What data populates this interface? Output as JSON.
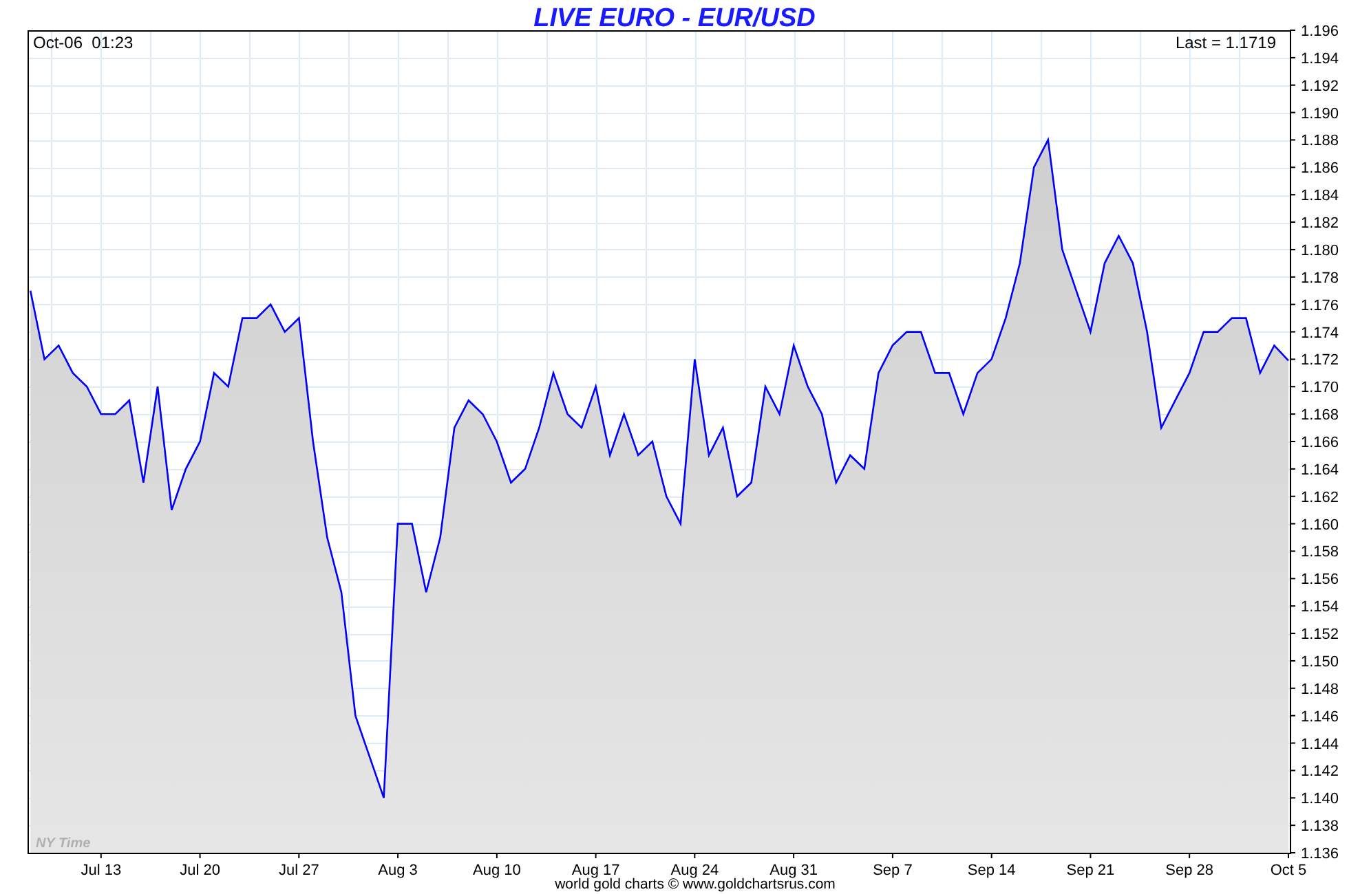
{
  "chart": {
    "timestamp": "Oct-06  01:23",
    "last_price": "Last = 1.1719",
    "timezone_label": "NY Time",
    "footer": "world gold charts © www.goldchartsrus.com",
    "chart_data": {
      "type": "area",
      "title": "LIVE EURO - EUR/USD",
      "categories": [
        null,
        null,
        null,
        null,
        null,
        "Jul 13",
        null,
        null,
        null,
        null,
        null,
        null,
        "Jul 20",
        null,
        null,
        null,
        null,
        null,
        null,
        "Jul 27",
        null,
        null,
        null,
        null,
        null,
        null,
        "Aug 3",
        null,
        null,
        null,
        null,
        null,
        null,
        "Aug 10",
        null,
        null,
        null,
        null,
        null,
        null,
        "Aug 17",
        null,
        null,
        null,
        null,
        null,
        null,
        "Aug 24",
        null,
        null,
        null,
        null,
        null,
        null,
        "Aug 31",
        null,
        null,
        null,
        null,
        null,
        null,
        "Sep 7",
        null,
        null,
        null,
        null,
        null,
        null,
        "Sep 14",
        null,
        null,
        null,
        null,
        null,
        null,
        "Sep 21",
        null,
        null,
        null,
        null,
        null,
        null,
        "Sep 28",
        null,
        null,
        null,
        null,
        null,
        null,
        "Oct 5"
      ],
      "series": [
        {
          "color": "#0000ff",
          "values": [
            1.177,
            1.172,
            1.173,
            1.171,
            1.17,
            1.168,
            1.168,
            1.169,
            1.163,
            1.17,
            1.161,
            1.164,
            1.166,
            1.171,
            1.17,
            1.175,
            1.175,
            1.176,
            1.174,
            1.175,
            1.166,
            1.159,
            1.155,
            1.146,
            1.143,
            1.14,
            1.16,
            1.16,
            1.155,
            1.159,
            1.167,
            1.169,
            1.168,
            1.166,
            1.163,
            1.164,
            1.167,
            1.171,
            1.168,
            1.167,
            1.17,
            1.165,
            1.168,
            1.165,
            1.166,
            1.162,
            1.16,
            1.172,
            1.165,
            1.167,
            1.162,
            1.163,
            1.17,
            1.168,
            1.173,
            1.17,
            1.168,
            1.163,
            1.165,
            1.164,
            1.171,
            1.173,
            1.174,
            1.174,
            1.171,
            1.171,
            1.168,
            1.171,
            1.172,
            1.175,
            1.179,
            1.186,
            1.188,
            1.18,
            1.177,
            1.174,
            1.179,
            1.181,
            1.179,
            1.174,
            1.167,
            1.169,
            1.171,
            1.174,
            1.174,
            1.175,
            1.175,
            1.171,
            1.173,
            1.1719
          ]
        }
      ],
      "grid": true,
      "ylim": [
        1.136,
        1.196
      ],
      "yticks": [
        {
          "value": 1.136,
          "label": "1.136"
        },
        {
          "value": 1.138,
          "label": "1.138"
        },
        {
          "value": 1.14,
          "label": "1.140"
        },
        {
          "value": 1.142,
          "label": "1.142"
        },
        {
          "value": 1.144,
          "label": "1.144"
        },
        {
          "value": 1.146,
          "label": "1.146"
        },
        {
          "value": 1.148,
          "label": "1.148"
        },
        {
          "value": 1.15,
          "label": "1.150"
        },
        {
          "value": 1.152,
          "label": "1.152"
        },
        {
          "value": 1.154,
          "label": "1.154"
        },
        {
          "value": 1.156,
          "label": "1.156"
        },
        {
          "value": 1.158,
          "label": "1.158"
        },
        {
          "value": 1.16,
          "label": "1.160"
        },
        {
          "value": 1.162,
          "label": "1.162"
        },
        {
          "value": 1.164,
          "label": "1.164"
        },
        {
          "value": 1.166,
          "label": "1.166"
        },
        {
          "value": 1.168,
          "label": "1.168"
        },
        {
          "value": 1.17,
          "label": "1.170"
        },
        {
          "value": 1.172,
          "label": "1.172"
        },
        {
          "value": 1.174,
          "label": "1.174"
        },
        {
          "value": 1.176,
          "label": "1.176"
        },
        {
          "value": 1.178,
          "label": "1.178"
        },
        {
          "value": 1.18,
          "label": "1.180"
        },
        {
          "value": 1.182,
          "label": "1.182"
        },
        {
          "value": 1.184,
          "label": "1.184"
        },
        {
          "value": 1.186,
          "label": "1.186"
        },
        {
          "value": 1.188,
          "label": "1.188"
        },
        {
          "value": 1.19,
          "label": "1.190"
        },
        {
          "value": 1.192,
          "label": "1.192"
        },
        {
          "value": 1.194,
          "label": "1.194"
        },
        {
          "value": 1.196,
          "label": "1.196"
        }
      ]
    }
  }
}
